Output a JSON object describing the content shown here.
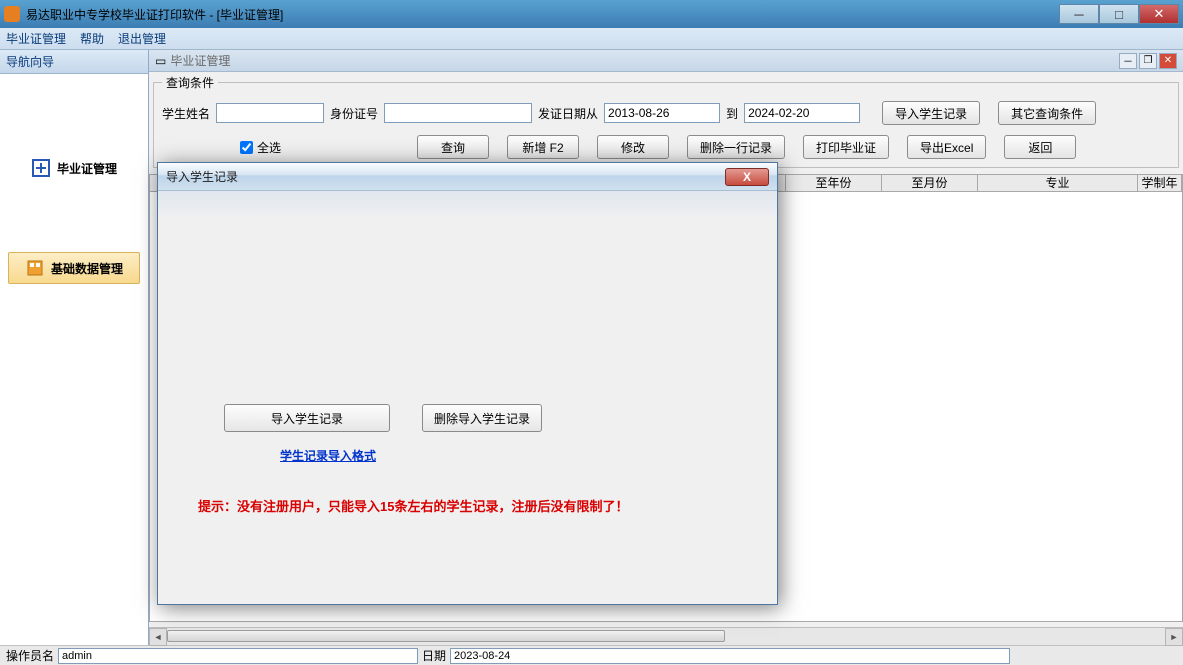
{
  "window": {
    "title": "易达职业中专学校毕业证打印软件   - [毕业证管理]"
  },
  "menubar": {
    "m1": "毕业证管理",
    "m2": "帮助",
    "m3": "退出管理"
  },
  "leftnav": {
    "header": "导航向导",
    "item1": "毕业证管理",
    "item2": "基础数据管理"
  },
  "mdi": {
    "title": "毕业证管理"
  },
  "query": {
    "legend": "查询条件",
    "name_label": "学生姓名",
    "name_value": "",
    "id_label": "身份证号",
    "id_value": "",
    "date_from_label": "发证日期从",
    "date_from_value": "2013-08-26",
    "date_to_label": "到",
    "date_to_value": "2024-02-20",
    "import_btn": "导入学生记录",
    "other_btn": "其它查询条件",
    "select_all": "全选",
    "btn_query": "查询",
    "btn_new": "新增 F2",
    "btn_edit": "修改",
    "btn_delete": "删除一行记录",
    "btn_print": "打印毕业证",
    "btn_export": "导出Excel",
    "btn_back": "返回"
  },
  "grid": {
    "col1": "至年份",
    "col2": "至月份",
    "col3": "专业",
    "col4": "学制年"
  },
  "dialog": {
    "title": "导入学生记录",
    "btn_import": "导入学生记录",
    "btn_delete_import": "删除导入学生记录",
    "link_format": "学生记录导入格式",
    "tip": "提示：没有注册用户，只能导入15条左右的学生记录，注册后没有限制了！"
  },
  "status": {
    "operator_label": "操作员名",
    "operator_value": "admin",
    "date_label": "日期",
    "date_value": "2023-08-24"
  }
}
